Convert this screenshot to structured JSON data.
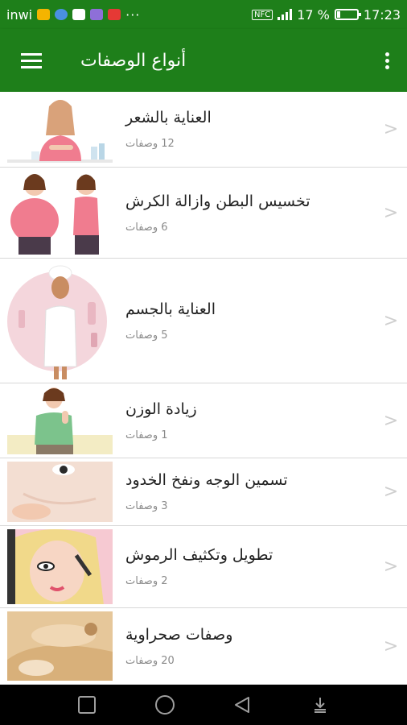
{
  "status": {
    "carrier": "inwi",
    "dots": "···",
    "nfc": "NFC",
    "battery_text": "17 %",
    "battery_level": 0.17,
    "time": "17:23"
  },
  "app_bar": {
    "title": "أنواع الوصفات"
  },
  "categories": [
    {
      "title": "العناية بالشعر",
      "count": "12 وصفات"
    },
    {
      "title": "تخسيس البطن وازالة الكرش",
      "count": "6 وصفات"
    },
    {
      "title": "العناية بالجسم",
      "count": "5 وصفات"
    },
    {
      "title": "زيادة الوزن",
      "count": "1 وصفات"
    },
    {
      "title": "تسمين الوجه ونفخ الخدود",
      "count": "3 وصفات"
    },
    {
      "title": "تطويل وتكثيف الرموش",
      "count": "2 وصفات"
    },
    {
      "title": "وصفات صحراوية",
      "count": "20 وصفات"
    }
  ],
  "chevron": ">",
  "colors": {
    "primary": "#1e7f1a",
    "divider": "#d8d8d8",
    "subtext": "#8a8a8a"
  }
}
